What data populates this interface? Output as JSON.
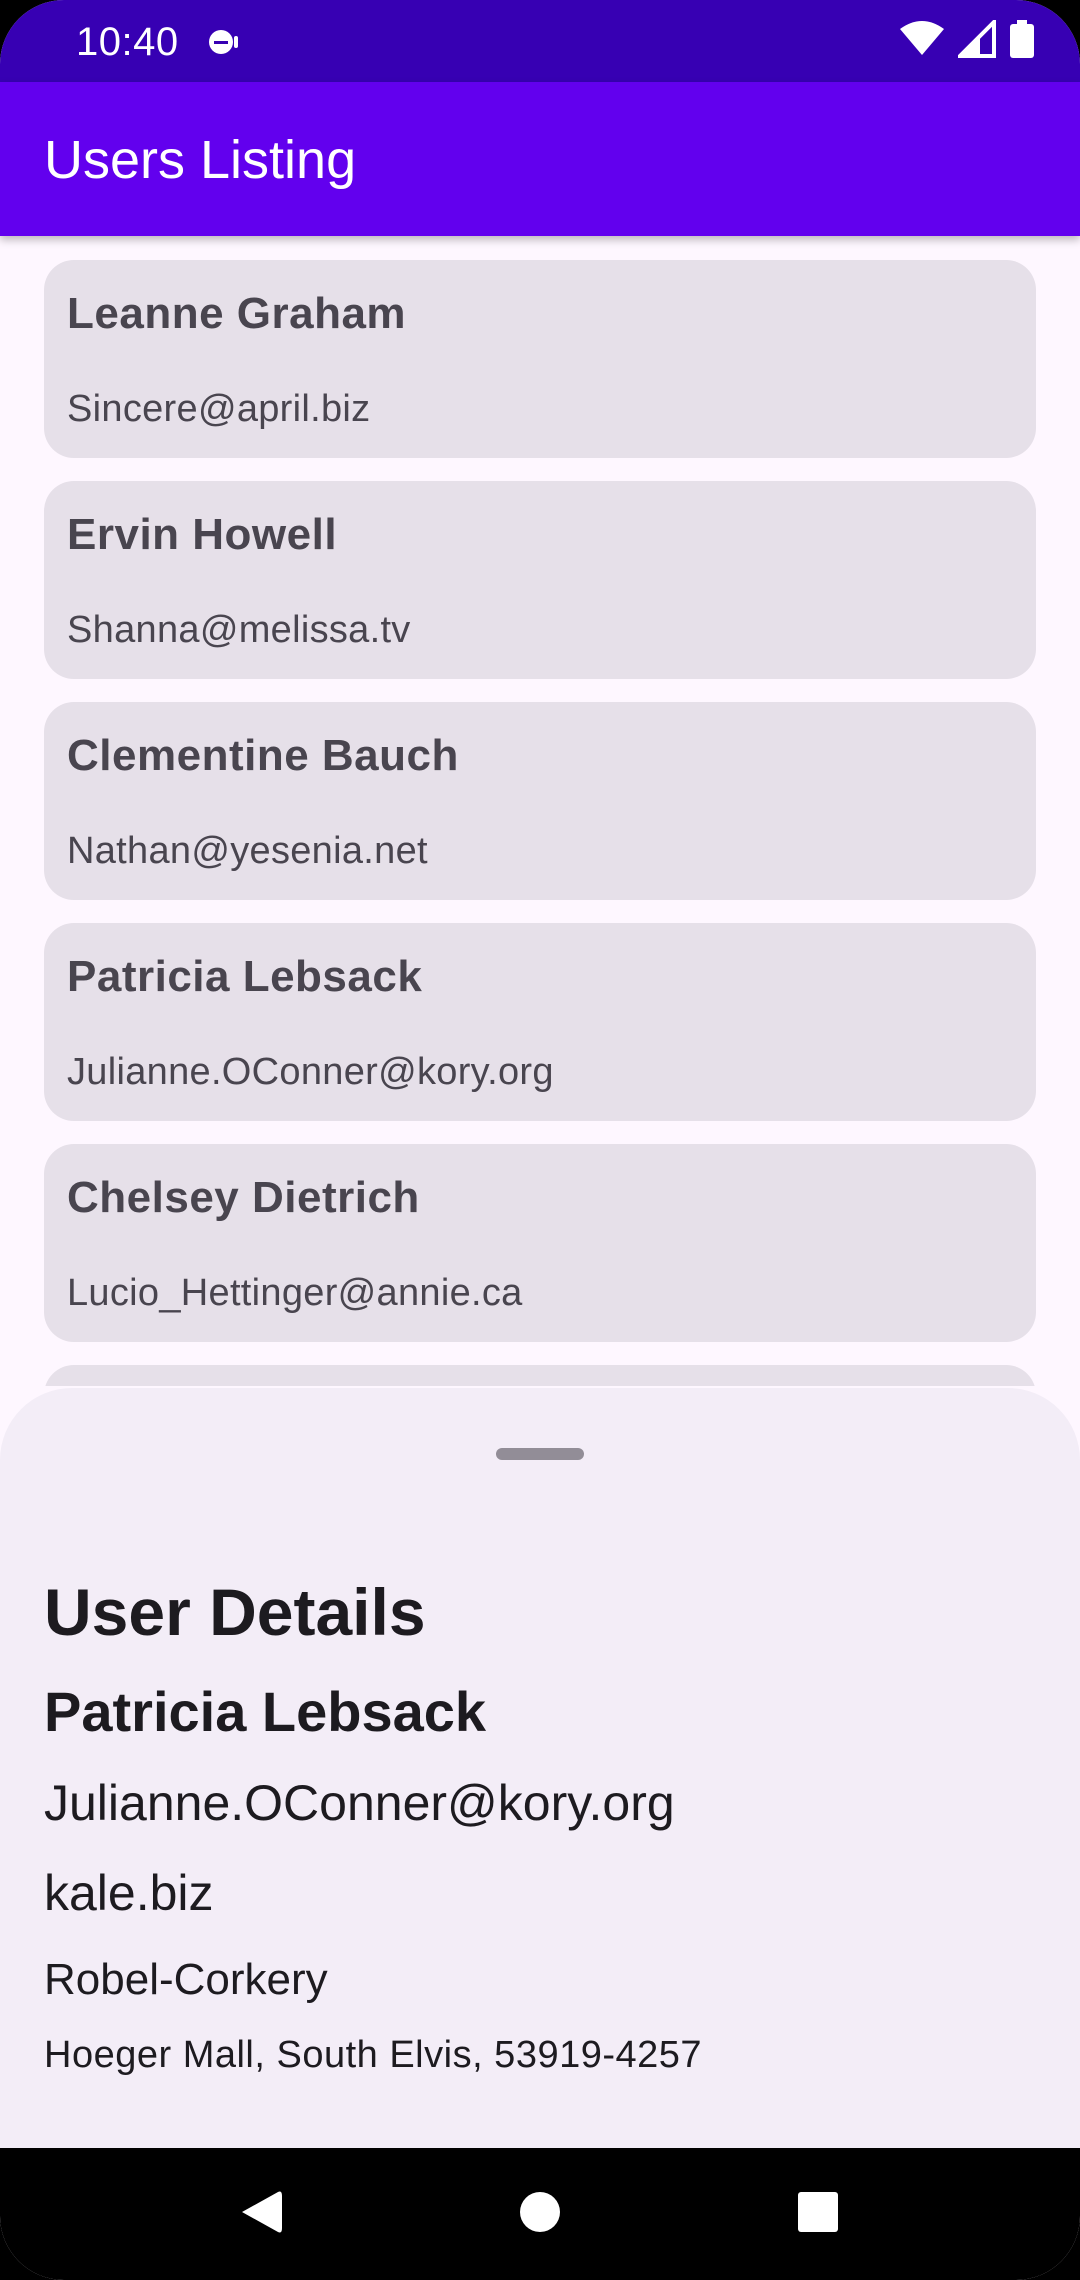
{
  "status_bar": {
    "time": "10:40",
    "icons": [
      "notification-icon",
      "wifi-icon",
      "signal-icon",
      "battery-icon"
    ]
  },
  "app_bar": {
    "title": "Users Listing"
  },
  "users": [
    {
      "name": "Leanne Graham",
      "email": "Sincere@april.biz"
    },
    {
      "name": "Ervin Howell",
      "email": "Shanna@melissa.tv"
    },
    {
      "name": "Clementine Bauch",
      "email": "Nathan@yesenia.net"
    },
    {
      "name": "Patricia Lebsack",
      "email": "Julianne.OConner@kory.org"
    },
    {
      "name": "Chelsey Dietrich",
      "email": "Lucio_Hettinger@annie.ca"
    }
  ],
  "details": {
    "title": "User Details",
    "name": "Patricia Lebsack",
    "email": "Julianne.OConner@kory.org",
    "website": "kale.biz",
    "company": "Robel-Corkery",
    "address": "Hoeger Mall, South Elvis, 53919-4257"
  },
  "nav_bar": {
    "buttons": [
      "back-icon",
      "home-icon",
      "recents-icon"
    ]
  },
  "colors": {
    "status_bar": "#3700B3",
    "app_bar": "#6200EE",
    "card": "#E6E0E9",
    "sheet": "#F3EDF7",
    "background": "#FEF7FF"
  }
}
